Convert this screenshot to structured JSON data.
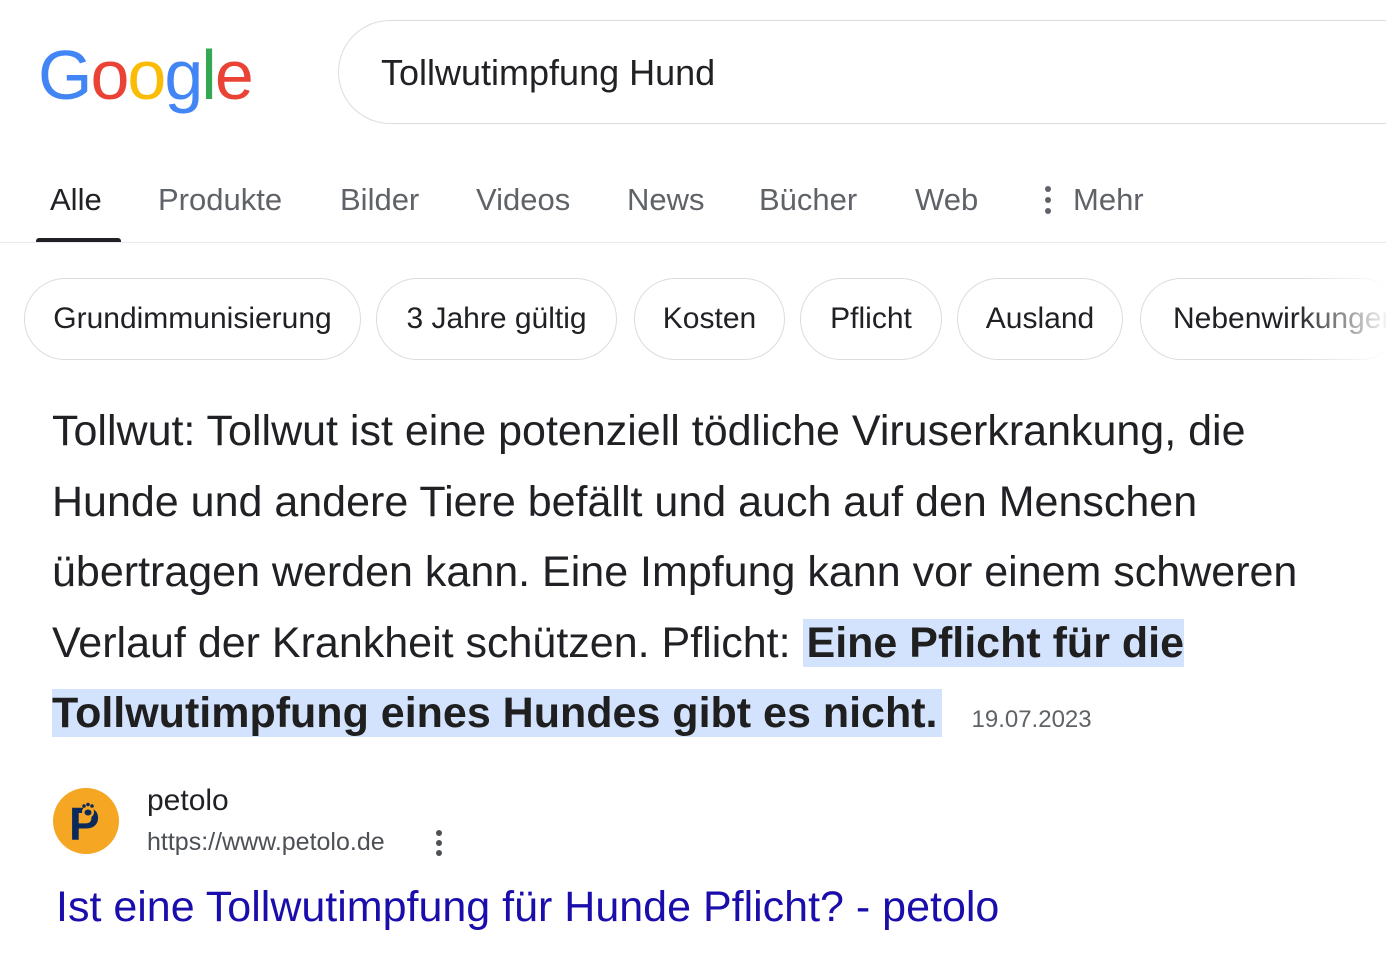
{
  "logo": {
    "letters": [
      "G",
      "o",
      "o",
      "g",
      "l",
      "e"
    ],
    "colors": [
      "#4285F4",
      "#EA4335",
      "#FBBC05",
      "#4285F4",
      "#34A853",
      "#EA4335"
    ]
  },
  "search": {
    "query": "Tollwutimpfung Hund"
  },
  "tabs": [
    {
      "label": "Alle",
      "active": true
    },
    {
      "label": "Produkte"
    },
    {
      "label": "Bilder"
    },
    {
      "label": "Videos"
    },
    {
      "label": "News"
    },
    {
      "label": "Bücher"
    },
    {
      "label": "Web"
    },
    {
      "label": "Mehr",
      "icon": "more-vert-icon"
    }
  ],
  "chips": [
    "Grundimmunisierung",
    "3 Jahre gültig",
    "Kosten",
    "Pflicht",
    "Ausland",
    "Nebenwirkungen"
  ],
  "snippet": {
    "text": "Tollwut: Tollwut ist eine potenziell tödliche Viruserkrankung, die Hunde und andere Tiere befällt und auch auf den Menschen übertragen werden kann. Eine Impfung kann vor einem schweren Verlauf der Krankheit schützen. Pflicht: ",
    "highlight": "Eine Pflicht für die Tollwutimpfung eines Hundes gibt es nicht.",
    "date": "19.07.2023"
  },
  "source": {
    "favicon_letter": "P",
    "favicon_color": "#F5A623",
    "name": "petolo",
    "url": "https://www.petolo.de",
    "title": "Ist eine Tollwutimpfung für Hunde Pflicht? - petolo",
    "title_color": "#1A0DAB"
  },
  "colors": {
    "highlight_bg": "#D3E3FD",
    "text": "#202124",
    "secondary": "#5F6368"
  }
}
